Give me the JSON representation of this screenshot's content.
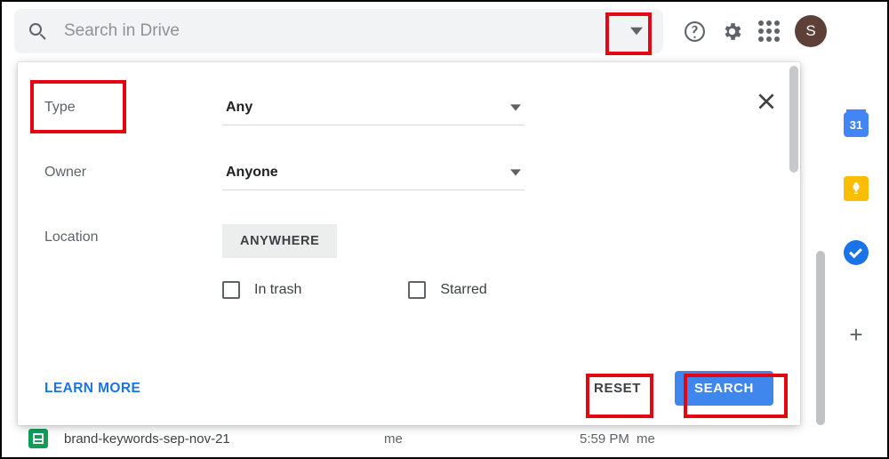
{
  "search": {
    "placeholder": "Search in Drive"
  },
  "avatar": {
    "initial": "S"
  },
  "sidepanel": {
    "calendar_day": "31"
  },
  "panel": {
    "rows": {
      "type": {
        "label": "Type",
        "value": "Any"
      },
      "owner": {
        "label": "Owner",
        "value": "Anyone"
      },
      "location": {
        "label": "Location",
        "chip": "ANYWHERE"
      }
    },
    "checks": {
      "in_trash": "In trash",
      "starred": "Starred"
    },
    "footer": {
      "learn_more": "LEARN MORE",
      "reset": "RESET",
      "search": "SEARCH"
    }
  },
  "file_row": {
    "name": "brand-keywords-sep-nov-21",
    "owner": "me",
    "modified_time": "5:59 PM",
    "modified_by": "me"
  }
}
